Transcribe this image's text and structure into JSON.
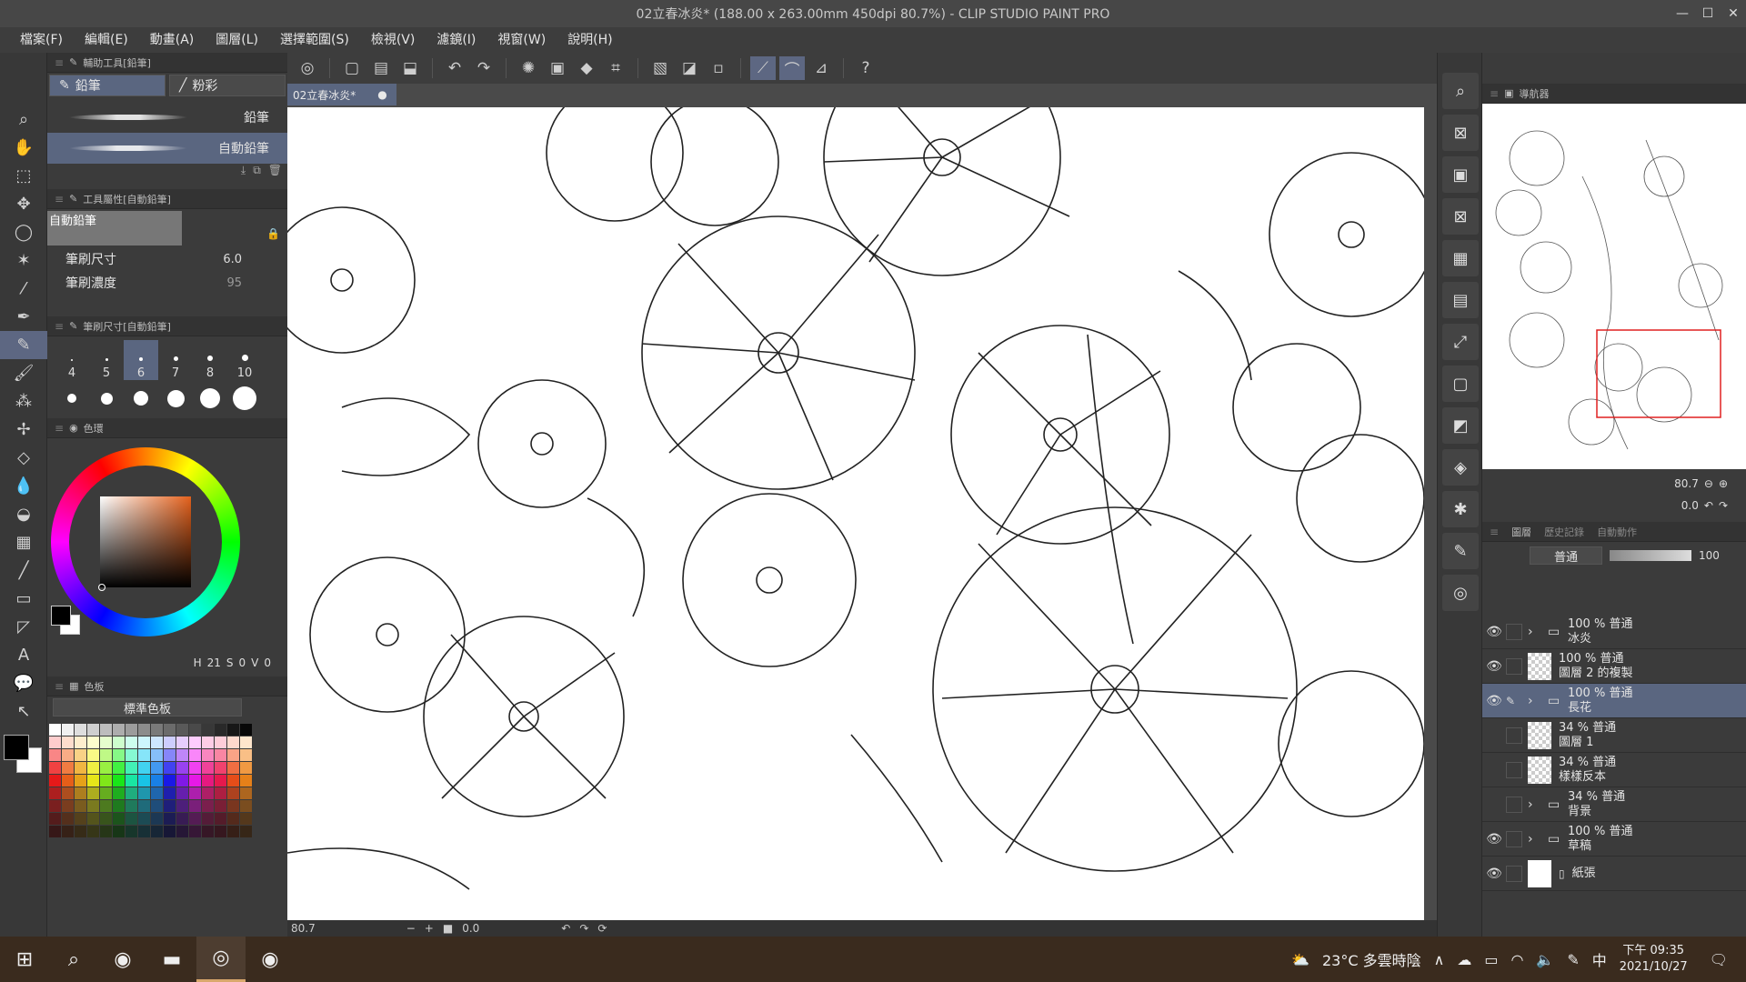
{
  "window": {
    "title": "02立春冰炎* (188.00 x 263.00mm 450dpi 80.7%)  - CLIP STUDIO PAINT PRO"
  },
  "menu": [
    "檔案(F)",
    "編輯(E)",
    "動畫(A)",
    "圖層(L)",
    "選擇範圍(S)",
    "檢視(V)",
    "濾鏡(I)",
    "視窗(W)",
    "說明(H)"
  ],
  "subtool_panel": {
    "header": "輔助工具[鉛筆]",
    "tabs": [
      "鉛筆",
      "粉彩"
    ],
    "brushes": [
      "鉛筆",
      "自動鉛筆"
    ]
  },
  "tool_property_panel": {
    "header": "工具屬性[自動鉛筆]",
    "preview_name": "自動鉛筆",
    "brush_size_label": "筆刷尺寸",
    "brush_size_value": "6.0",
    "brush_density_label": "筆刷濃度",
    "brush_density_value": "95"
  },
  "brush_size_panel": {
    "header": "筆刷尺寸[自動鉛筆]",
    "sizes": [
      "4",
      "5",
      "6",
      "7",
      "8",
      "10"
    ],
    "selected": "6"
  },
  "color_panel": {
    "header": "色環",
    "h_label": "H",
    "h_value": "21",
    "s_label": "S",
    "s_value": "0",
    "v_label": "V",
    "v_value": "0"
  },
  "palette_panel": {
    "header": "色板",
    "selected_palette": "標準色板"
  },
  "canvas": {
    "doc_tab": "02立春冰炎*",
    "zoom": "80.7",
    "angle": "0.0"
  },
  "navigator": {
    "header": "導航器",
    "zoom": "80.7",
    "rotation": "0.0"
  },
  "layer_panel": {
    "tabs": [
      "圖層",
      "歷史記錄",
      "自動動作"
    ],
    "blend_mode": "普通",
    "opacity": "100",
    "layers": [
      {
        "opacity": "100 %",
        "mode": "普通",
        "name": "冰炎",
        "folder": true,
        "visible": true
      },
      {
        "opacity": "100 %",
        "mode": "普通",
        "name": "圖層 2 的複製",
        "folder": false,
        "visible": true
      },
      {
        "opacity": "100 %",
        "mode": "普通",
        "name": "長花",
        "folder": true,
        "visible": true,
        "active": true
      },
      {
        "opacity": "34 %",
        "mode": "普通",
        "name": "圖層 1",
        "folder": false,
        "visible": false
      },
      {
        "opacity": "34 %",
        "mode": "普通",
        "name": "樣樣反本",
        "folder": false,
        "visible": false
      },
      {
        "opacity": "34 %",
        "mode": "普通",
        "name": "背景",
        "folder": true,
        "visible": false
      },
      {
        "opacity": "100 %",
        "mode": "普通",
        "name": "草稿",
        "folder": true,
        "visible": true
      },
      {
        "opacity": "",
        "mode": "",
        "name": "紙張",
        "folder": false,
        "visible": true,
        "paper": true
      }
    ]
  },
  "taskbar": {
    "weather": "23°C  多雲時陰",
    "ime": "中",
    "time": "下午 09:35",
    "date": "2021/10/27"
  }
}
